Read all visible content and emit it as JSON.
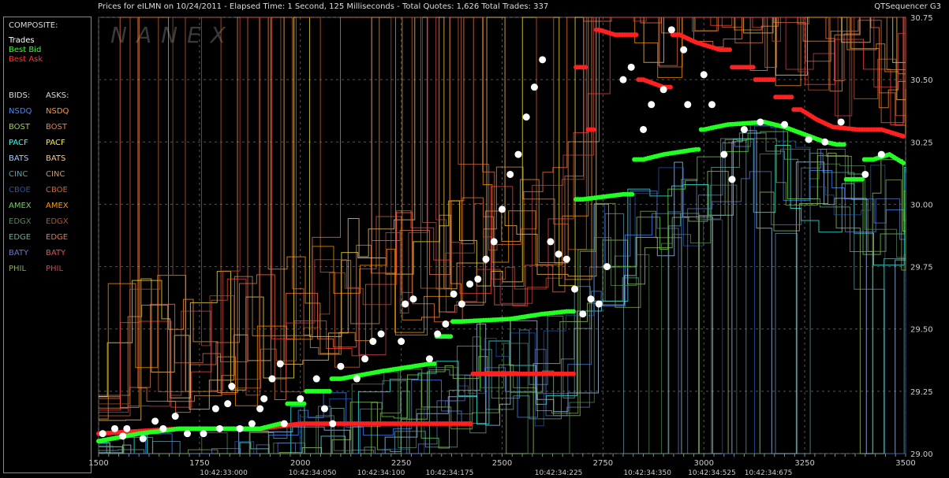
{
  "header": {
    "title_text": "Prices for  eILMN  on  10/24/2011  -  Elapsed Time: 1 Second, 125 Milliseconds  -  Total Quotes: 1,626  Total Trades: 337",
    "app_name": "QTSequencer G3"
  },
  "watermark": "NANEX",
  "sidebar": {
    "composite_label": "COMPOSITE:",
    "composite_items": [
      {
        "label": "Trades",
        "color": "#ffffff"
      },
      {
        "label": "Best Bid",
        "color": "#33ff33"
      },
      {
        "label": "Best Ask",
        "color": "#ff3333"
      }
    ],
    "bids_label": "BIDS:",
    "asks_label": "ASKS:",
    "exchanges": [
      {
        "bid": "NSDQ",
        "ask": "NSDQ",
        "bid_color": "#4488ff",
        "ask_color": "#ff9933"
      },
      {
        "bid": "BOST",
        "ask": "BOST",
        "bid_color": "#99cc66",
        "ask_color": "#ff7744"
      },
      {
        "bid": "PACF",
        "ask": "PACF",
        "bid_color": "#33ffee",
        "ask_color": "#ffee33"
      },
      {
        "bid": "BATS",
        "ask": "BATS",
        "bid_color": "#aaccff",
        "ask_color": "#ffcc66"
      },
      {
        "bid": "CINC",
        "ask": "CINC",
        "bid_color": "#6699aa",
        "ask_color": "#cc9966"
      },
      {
        "bid": "CBOE",
        "ask": "CBOE",
        "bid_color": "#2255aa",
        "ask_color": "#cc6633"
      },
      {
        "bid": "AMEX",
        "ask": "AMEX",
        "bid_color": "#66dd44",
        "ask_color": "#ff9900"
      },
      {
        "bid": "EDGX",
        "ask": "EDGX",
        "bid_color": "#558855",
        "ask_color": "#aa5533"
      },
      {
        "bid": "EDGE",
        "ask": "EDGE",
        "bid_color": "#66aa99",
        "ask_color": "#dd7755"
      },
      {
        "bid": "BATY",
        "ask": "BATY",
        "bid_color": "#6677cc",
        "ask_color": "#ff4444"
      },
      {
        "bid": "PHIL",
        "ask": "PHIL",
        "bid_color": "#88aa55",
        "ask_color": "#cc4455"
      }
    ]
  },
  "chart_data": {
    "type": "scatter",
    "x_ticks": [
      1500,
      1750,
      2000,
      2250,
      2500,
      2750,
      3000,
      3250,
      3500
    ],
    "xlim": [
      1500,
      3500
    ],
    "y_ticks": [
      "30.75",
      "30.50",
      "30.25",
      "30.00",
      "29.75",
      "29.50",
      "29.25",
      "29.00"
    ],
    "ylim": [
      29.0,
      30.75
    ],
    "time_labels": [
      {
        "x": 1810,
        "label": "10:42:33:000"
      },
      {
        "x": 2030,
        "label": "10:42:34:050"
      },
      {
        "x": 2200,
        "label": "10:42:34:100"
      },
      {
        "x": 2370,
        "label": "10:42:34:175"
      },
      {
        "x": 2640,
        "label": "10:42:34:225"
      },
      {
        "x": 2860,
        "label": "10:42:34:350"
      },
      {
        "x": 3020,
        "label": "10:42:34:525"
      },
      {
        "x": 3160,
        "label": "10:42:34:675"
      }
    ],
    "best_bid": [
      [
        1500,
        29.05
      ],
      [
        1600,
        29.08
      ],
      [
        1700,
        29.1
      ],
      [
        1800,
        29.1
      ],
      [
        1900,
        29.1
      ],
      [
        1950,
        29.12
      ],
      [
        1980,
        29.2
      ],
      [
        2050,
        29.25
      ],
      [
        2100,
        29.3
      ],
      [
        2200,
        29.33
      ],
      [
        2320,
        29.36
      ],
      [
        2350,
        29.47
      ],
      [
        2400,
        29.53
      ],
      [
        2520,
        29.54
      ],
      [
        2600,
        29.56
      ],
      [
        2660,
        29.57
      ],
      [
        2700,
        30.02
      ],
      [
        2800,
        30.04
      ],
      [
        2850,
        30.18
      ],
      [
        2900,
        30.2
      ],
      [
        2980,
        30.22
      ],
      [
        3000,
        30.3
      ],
      [
        3060,
        30.32
      ],
      [
        3150,
        30.33
      ],
      [
        3200,
        30.31
      ],
      [
        3250,
        30.28
      ],
      [
        3300,
        30.25
      ],
      [
        3330,
        30.24
      ],
      [
        3370,
        30.1
      ],
      [
        3420,
        30.18
      ],
      [
        3460,
        30.2
      ],
      [
        3500,
        30.16
      ]
    ],
    "best_ask": [
      [
        1500,
        29.08
      ],
      [
        1600,
        29.09
      ],
      [
        1700,
        29.1
      ],
      [
        1800,
        29.1
      ],
      [
        1900,
        29.1
      ],
      [
        1950,
        29.11
      ],
      [
        2000,
        29.12
      ],
      [
        2100,
        29.12
      ],
      [
        2200,
        29.12
      ],
      [
        2300,
        29.12
      ],
      [
        2400,
        29.12
      ],
      [
        2450,
        29.32
      ],
      [
        2500,
        29.32
      ],
      [
        2560,
        29.32
      ],
      [
        2600,
        29.32
      ],
      [
        2660,
        29.32
      ],
      [
        2700,
        30.55
      ],
      [
        2720,
        30.3
      ],
      [
        2740,
        30.7
      ],
      [
        2780,
        30.68
      ],
      [
        2820,
        30.68
      ],
      [
        2850,
        30.5
      ],
      [
        2900,
        30.47
      ],
      [
        2940,
        30.68
      ],
      [
        2980,
        30.65
      ],
      [
        3040,
        30.62
      ],
      [
        3100,
        30.55
      ],
      [
        3150,
        30.5
      ],
      [
        3200,
        30.43
      ],
      [
        3240,
        30.38
      ],
      [
        3280,
        30.34
      ],
      [
        3320,
        30.31
      ],
      [
        3380,
        30.3
      ],
      [
        3440,
        30.3
      ],
      [
        3500,
        30.27
      ]
    ],
    "trades": [
      [
        1510,
        29.08
      ],
      [
        1540,
        29.1
      ],
      [
        1560,
        29.07
      ],
      [
        1570,
        29.1
      ],
      [
        1610,
        29.06
      ],
      [
        1640,
        29.13
      ],
      [
        1660,
        29.1
      ],
      [
        1690,
        29.15
      ],
      [
        1720,
        29.08
      ],
      [
        1760,
        29.08
      ],
      [
        1790,
        29.18
      ],
      [
        1800,
        29.1
      ],
      [
        1820,
        29.2
      ],
      [
        1830,
        29.27
      ],
      [
        1850,
        29.1
      ],
      [
        1880,
        29.12
      ],
      [
        1900,
        29.18
      ],
      [
        1910,
        29.22
      ],
      [
        1930,
        29.3
      ],
      [
        1950,
        29.36
      ],
      [
        1960,
        29.12
      ],
      [
        2000,
        29.22
      ],
      [
        2040,
        29.3
      ],
      [
        2060,
        29.18
      ],
      [
        2080,
        29.12
      ],
      [
        2100,
        29.35
      ],
      [
        2140,
        29.3
      ],
      [
        2160,
        29.38
      ],
      [
        2180,
        29.45
      ],
      [
        2200,
        29.48
      ],
      [
        2250,
        29.45
      ],
      [
        2260,
        29.6
      ],
      [
        2280,
        29.62
      ],
      [
        2320,
        29.38
      ],
      [
        2340,
        29.48
      ],
      [
        2360,
        29.52
      ],
      [
        2380,
        29.64
      ],
      [
        2400,
        29.6
      ],
      [
        2420,
        29.68
      ],
      [
        2440,
        29.7
      ],
      [
        2460,
        29.78
      ],
      [
        2480,
        29.85
      ],
      [
        2500,
        29.98
      ],
      [
        2520,
        30.12
      ],
      [
        2540,
        30.2
      ],
      [
        2560,
        30.35
      ],
      [
        2580,
        30.47
      ],
      [
        2600,
        30.58
      ],
      [
        2620,
        29.85
      ],
      [
        2640,
        29.8
      ],
      [
        2660,
        29.78
      ],
      [
        2680,
        29.66
      ],
      [
        2700,
        29.56
      ],
      [
        2720,
        29.62
      ],
      [
        2740,
        29.6
      ],
      [
        2760,
        29.75
      ],
      [
        2800,
        30.5
      ],
      [
        2820,
        30.55
      ],
      [
        2850,
        30.3
      ],
      [
        2870,
        30.4
      ],
      [
        2900,
        30.46
      ],
      [
        2920,
        30.7
      ],
      [
        2950,
        30.62
      ],
      [
        2960,
        30.4
      ],
      [
        3000,
        30.52
      ],
      [
        3020,
        30.4
      ],
      [
        3050,
        30.2
      ],
      [
        3070,
        30.1
      ],
      [
        3100,
        30.3
      ],
      [
        3140,
        30.33
      ],
      [
        3200,
        30.32
      ],
      [
        3260,
        30.26
      ],
      [
        3300,
        30.25
      ],
      [
        3340,
        30.33
      ],
      [
        3400,
        30.12
      ],
      [
        3440,
        30.2
      ]
    ]
  }
}
